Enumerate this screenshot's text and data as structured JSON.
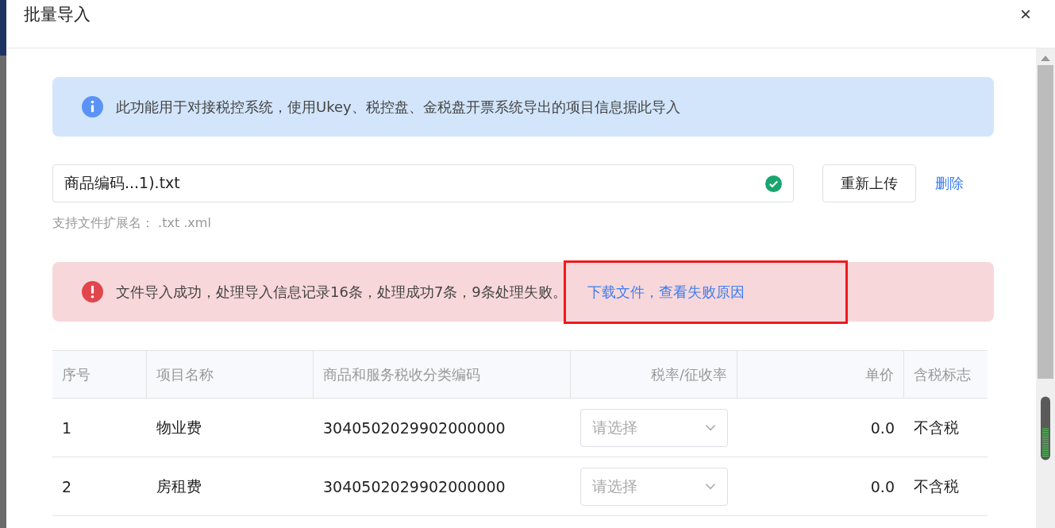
{
  "dialog": {
    "title": "批量导入",
    "close": "×"
  },
  "info_alert": {
    "text": "此功能用于对接税控系统，使用Ukey、税控盘、金税盘开票系统导出的项目信息据此导入"
  },
  "upload": {
    "file_name": "商品编码...1).txt",
    "uploaded": true,
    "reupload_button": "重新上传",
    "delete_link": "删除",
    "hint": "支持文件扩展名： .txt .xml"
  },
  "result_alert": {
    "text": "文件导入成功，处理导入信息记录16条，处理成功7条，9条处理失败。",
    "link": "下载文件，查看失败原因",
    "highlighted": true
  },
  "table": {
    "columns": [
      {
        "label": "序号"
      },
      {
        "label": "项目名称"
      },
      {
        "label": "商品和服务税收分类编码"
      },
      {
        "label": "税率/征收率"
      },
      {
        "label": "单价"
      },
      {
        "label": "含税标志"
      }
    ],
    "rows": [
      {
        "index": "1",
        "name": "物业费",
        "code": "3040502029902000000",
        "rate_placeholder": "请选择",
        "price": "0.0",
        "tax_flag": "不含税"
      },
      {
        "index": "2",
        "name": "房租费",
        "code": "3040502029902000000",
        "rate_placeholder": "请选择",
        "price": "0.0",
        "tax_flag": "不含税"
      }
    ]
  }
}
